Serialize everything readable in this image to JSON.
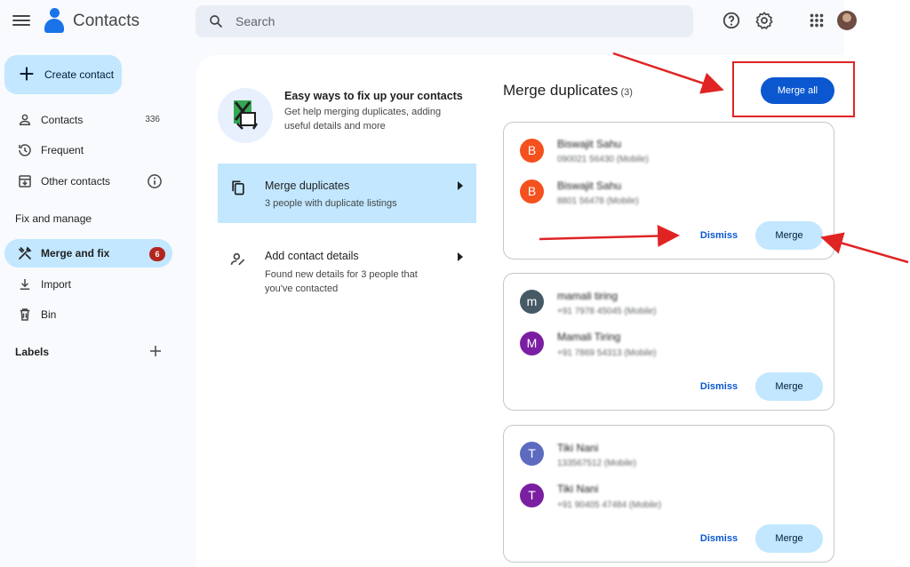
{
  "app": {
    "title": "Contacts"
  },
  "search": {
    "placeholder": "Search"
  },
  "sidebar": {
    "create_label": "Create contact",
    "items": [
      {
        "label": "Contacts",
        "count": "336"
      },
      {
        "label": "Frequent"
      },
      {
        "label": "Other contacts"
      },
      {
        "label": "Merge and fix",
        "badge": "6"
      },
      {
        "label": "Import"
      },
      {
        "label": "Bin"
      }
    ],
    "fix_heading": "Fix and manage",
    "labels_heading": "Labels"
  },
  "fix": {
    "title": "Easy ways to fix up your contacts",
    "subtitle": "Get help merging duplicates, adding useful details and more"
  },
  "options": [
    {
      "title": "Merge duplicates",
      "subtitle": "3 people with duplicate listings"
    },
    {
      "title": "Add contact details",
      "subtitle": "Found new details for 3 people that you've contacted"
    }
  ],
  "merge": {
    "heading": "Merge duplicates",
    "count": "(3)",
    "merge_all_label": "Merge all",
    "dismiss_label": "Dismiss",
    "merge_label": "Merge"
  },
  "cards": [
    {
      "contacts": [
        {
          "initial": "B",
          "name": "Biswajit Sahu",
          "phone": "090021 56430 (Mobile)"
        },
        {
          "initial": "B",
          "name": "Biswajit Sahu",
          "phone": "8801 56478 (Mobile)"
        }
      ]
    },
    {
      "contacts": [
        {
          "initial": "m",
          "name": "mamali tiring",
          "phone": "+91 7978 45045 (Mobile)"
        },
        {
          "initial": "M",
          "name": "Mamali Tiring",
          "phone": "+91 7869 54313 (Mobile)"
        }
      ]
    },
    {
      "contacts": [
        {
          "initial": "T",
          "name": "Tiki Nani",
          "phone": "133567512 (Mobile)"
        },
        {
          "initial": "T",
          "name": "Tiki Nani",
          "phone": "+91 90405 47484 (Mobile)"
        }
      ]
    }
  ],
  "colors": {
    "accent": "#0b57d0",
    "selected": "#c2e7ff",
    "badge": "#b3261e",
    "annotation": "#e02424",
    "avatar_orange": "#f4511e",
    "avatar_slate": "#455a64",
    "avatar_purple": "#7b1fa2",
    "avatar_indigo": "#5c6bc0"
  }
}
